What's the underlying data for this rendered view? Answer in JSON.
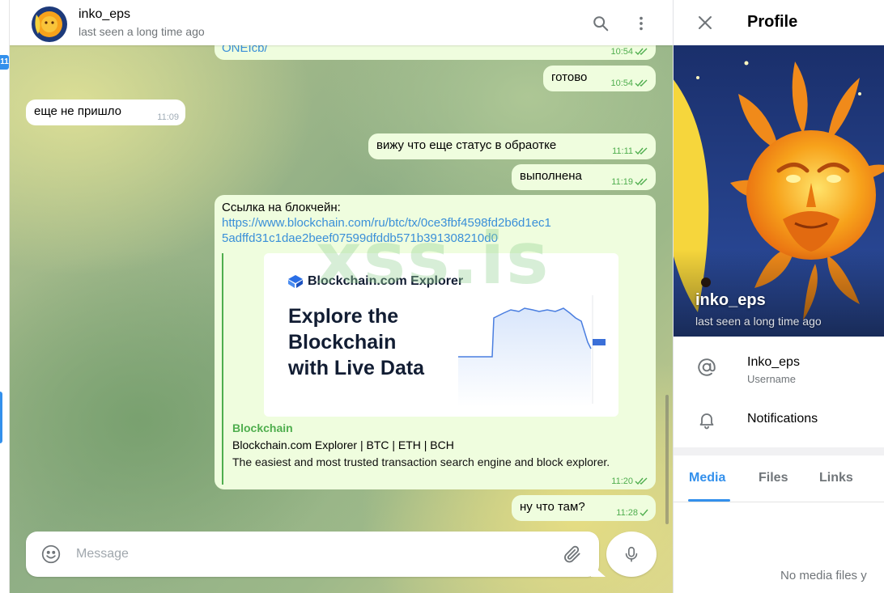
{
  "sidebar_badge": "11",
  "header": {
    "name": "inko_eps",
    "status": "last seen a long time ago"
  },
  "watermark": "xss.is",
  "messages": [
    {
      "direction": "out",
      "text": "ONEIcb/",
      "time": "10:54"
    },
    {
      "direction": "out",
      "text": "готово",
      "time": "10:54"
    },
    {
      "direction": "in",
      "text": "еще не пришло",
      "time": "11:09"
    },
    {
      "direction": "out",
      "text": "вижу что еще статус в обраотке",
      "time": "11:11"
    },
    {
      "direction": "out",
      "text": "выполнена",
      "time": "11:19"
    },
    {
      "direction": "out",
      "text": "Ссылка на блокчейн:",
      "link_line1": "https://www.blockchain.com/ru/btc/tx/0ce3fbf4598fd2b6d1ec1",
      "link_line2": "5adffd31c1dae2beef07599dfddb571b391308210d0",
      "time": "11:20"
    },
    {
      "direction": "out",
      "text": "ну что там?",
      "time": "11:28"
    }
  ],
  "link_preview": {
    "brand": "Blockchain",
    "brand_suffix": ".com Explorer",
    "headline": [
      "Explore the",
      "Blockchain",
      "with Live Data"
    ],
    "site_name": "Blockchain",
    "title": "Blockchain.com Explorer | BTC | ETH | BCH",
    "description": "The easiest and most trusted transaction search engine and block explorer."
  },
  "composer": {
    "placeholder": "Message"
  },
  "profile": {
    "title": "Profile",
    "name": "inko_eps",
    "status": "last seen a long time ago",
    "username": "Inko_eps",
    "username_label": "Username",
    "notifications_label": "Notifications",
    "tabs": [
      "Media",
      "Files",
      "Links"
    ],
    "empty_text": "No media files y"
  },
  "colors": {
    "accent": "#3390ec",
    "outgoing_bubble": "#effdde",
    "check_green": "#4fae4e",
    "link": "#3a8fd8"
  },
  "icons": [
    "search-icon",
    "more-vertical-icon",
    "emoji-icon",
    "attach-icon",
    "mic-icon",
    "close-icon",
    "at-icon",
    "bell-icon",
    "double-check-icon",
    "single-check-icon"
  ]
}
